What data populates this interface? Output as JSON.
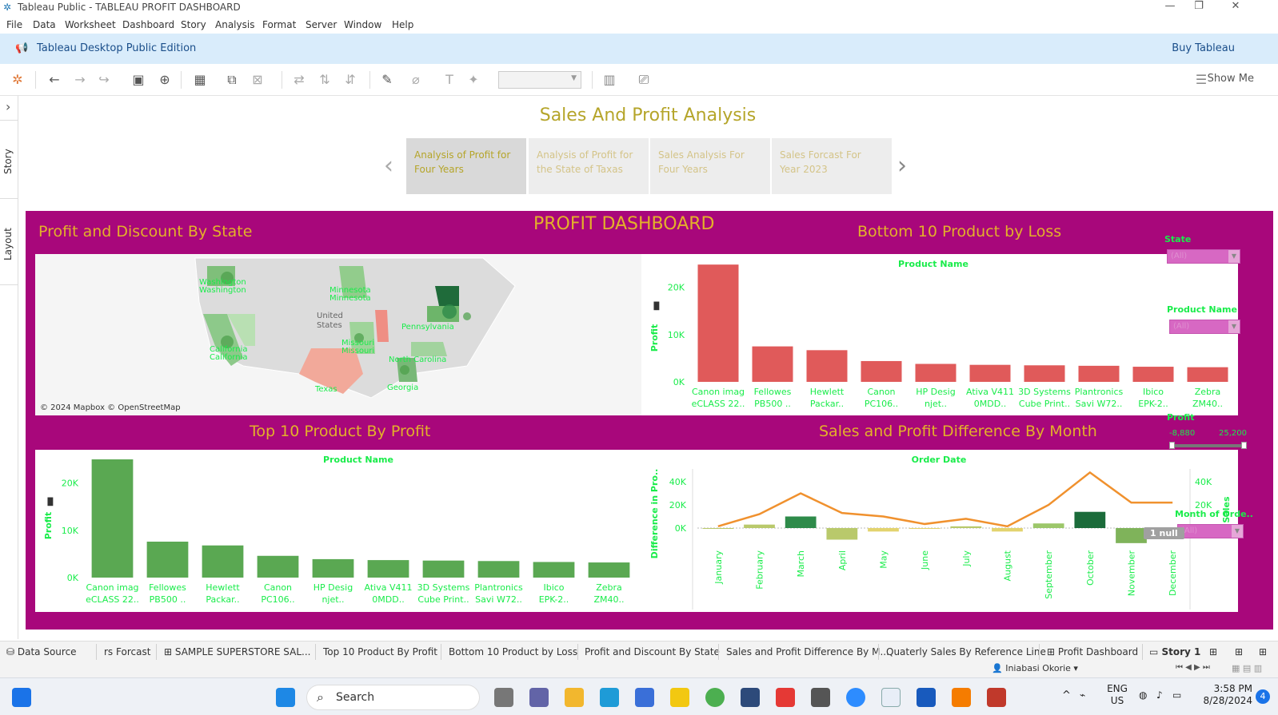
{
  "window": {
    "title": "Tableau Public - TABLEAU PROFIT DASHBOARD",
    "minimize": "—",
    "maximize": "❐",
    "close": "✕"
  },
  "menu": [
    "File",
    "Data",
    "Worksheet",
    "Dashboard",
    "Story",
    "Analysis",
    "Format",
    "Server",
    "Window",
    "Help"
  ],
  "infobar": {
    "edition": "Tableau Desktop Public Edition",
    "buy": "Buy Tableau"
  },
  "toolbar": {
    "show_me": "Show Me"
  },
  "side": {
    "story": "Story",
    "layout": "Layout",
    "expand": "›"
  },
  "story": {
    "title": "Sales And Profit Analysis",
    "points": [
      "Analysis of Profit for Four Years",
      "Analysis of Profit for the State of Taxas",
      "Sales Analysis For Four Years",
      "Sales Forcast For Year 2023"
    ],
    "prev": "‹",
    "next": "›"
  },
  "dashboard": {
    "title": "PROFIT DASHBOARD",
    "map": {
      "title": "Profit and Discount By State",
      "attribution": "© 2024 Mapbox © OpenStreetMap",
      "country": [
        "United",
        "States"
      ],
      "state_labels": [
        "Washington",
        "Washington",
        "California",
        "California",
        "Minnesota",
        "Minnesota",
        "Missouri",
        "Missouri",
        "Texas",
        "Georgia",
        "North Carolina",
        "Pennsylvania"
      ]
    },
    "bottom10": {
      "title": "Bottom 10 Product by Loss",
      "header": "Product Name",
      "ylabel": "Profit"
    },
    "top10": {
      "title": "Top 10 Product By Profit",
      "header": "Product Name",
      "ylabel": "Profit"
    },
    "monthly": {
      "title": "Sales and Profit Difference By Month",
      "header": "Order Date",
      "ylabel_left": "Difference in Pro..",
      "ylabel_right": "Sales"
    },
    "filters": {
      "state_label": "State",
      "state_value": "(All)",
      "product_label": "Product Name",
      "product_value": "(All)",
      "profit_label": "Profit",
      "profit_min": "-8,880",
      "profit_max": "25,200",
      "month_label": "Month of Orde..",
      "month_value": "(All)",
      "null_badge": "1 null"
    }
  },
  "sheet_tabs": [
    "Data Source",
    "rs Forcast",
    "SAMPLE SUPERSTORE SAL...",
    "Top 10 Product By Profit",
    "Bottom 10 Product by Loss",
    "Profit and Discount By State",
    "Sales and Profit Difference By M...",
    "Quaterly Sales By Reference Line",
    "Profit Dashboard",
    "Story 1"
  ],
  "status": {
    "user": "Iniabasi Okorie"
  },
  "taskbar": {
    "search": "Search",
    "lang1": "ENG",
    "lang2": "US",
    "time": "3:58 PM",
    "date": "8/28/2024",
    "badge": "4"
  },
  "colors": {
    "dashboard_bg": "#a8077b",
    "title_gold": "#e3b12a",
    "label_green": "#19ec4a",
    "loss_bar": "#e05a5a",
    "profit_bar": "#5aa852",
    "sales_line": "#f0912e"
  },
  "chart_data": [
    {
      "type": "bar",
      "title": "Bottom 10 Product by Loss",
      "xlabel": "Product Name",
      "ylabel": "Profit",
      "ylim": [
        0,
        25000
      ],
      "yticks": [
        "0K",
        "10K",
        "20K"
      ],
      "categories": [
        [
          "Canon imag",
          "eCLASS 22.."
        ],
        [
          "Fellowes",
          "PB500 .."
        ],
        [
          "Hewlett",
          "Packar.."
        ],
        [
          "Canon",
          "PC106.."
        ],
        [
          "HP Desig",
          "njet.."
        ],
        [
          "Ativa V411",
          "0MDD.."
        ],
        [
          "3D Systems",
          "Cube Print.."
        ],
        [
          "Plantronics",
          "Savi W72.."
        ],
        [
          "Ibico",
          "EPK-2.."
        ],
        [
          "Zebra",
          "ZM40.."
        ]
      ],
      "values": [
        24800,
        7500,
        6700,
        4400,
        3800,
        3600,
        3500,
        3400,
        3200,
        3100
      ],
      "color": "#e05a5a"
    },
    {
      "type": "bar",
      "title": "Top 10 Product By Profit",
      "xlabel": "Product Name",
      "ylabel": "Profit",
      "ylim": [
        0,
        25000
      ],
      "yticks": [
        "0K",
        "10K",
        "20K"
      ],
      "categories": [
        [
          "Canon imag",
          "eCLASS 22.."
        ],
        [
          "Fellowes",
          "PB500 .."
        ],
        [
          "Hewlett",
          "Packar.."
        ],
        [
          "Canon",
          "PC106.."
        ],
        [
          "HP Desig",
          "njet.."
        ],
        [
          "Ativa V411",
          "0MDD.."
        ],
        [
          "3D Systems",
          "Cube Print.."
        ],
        [
          "Plantronics",
          "Savi W72.."
        ],
        [
          "Ibico",
          "EPK-2.."
        ],
        [
          "Zebra",
          "ZM40.."
        ]
      ],
      "values": [
        25000,
        7600,
        6800,
        4600,
        3900,
        3700,
        3600,
        3500,
        3300,
        3200
      ],
      "color": "#5aa852"
    },
    {
      "type": "bar",
      "title": "Sales and Profit Difference By Month",
      "xlabel": "Order Date",
      "ylabel": "Difference in Pro..",
      "ylim": [
        -15000,
        45000
      ],
      "yticks": [
        "0K",
        "20K",
        "40K"
      ],
      "y2label": "Sales",
      "y2ticks": [
        "20K",
        "40K"
      ],
      "categories": [
        "January",
        "February",
        "March",
        "April",
        "May",
        "June",
        "July",
        "August",
        "September",
        "October",
        "November",
        "December"
      ],
      "series": [
        {
          "name": "Difference in Profit",
          "values": [
            0,
            3000,
            10000,
            -10000,
            -3000,
            -500,
            1500,
            -3000,
            4000,
            14000,
            -13000,
            0
          ],
          "colors": [
            "#b9c96b",
            "#b9c96b",
            "#2e8b4a",
            "#b9c96b",
            "#e3d36e",
            "#e3d36e",
            "#b9c96b",
            "#e3d36e",
            "#9cc76a",
            "#1b6b3a",
            "#7fb35a",
            "#b9c96b"
          ]
        },
        {
          "name": "Sales",
          "values": [
            1500,
            12000,
            30000,
            13000,
            10000,
            3500,
            8000,
            1500,
            20000,
            48000,
            22000,
            22000
          ],
          "color": "#f0912e"
        }
      ]
    }
  ]
}
